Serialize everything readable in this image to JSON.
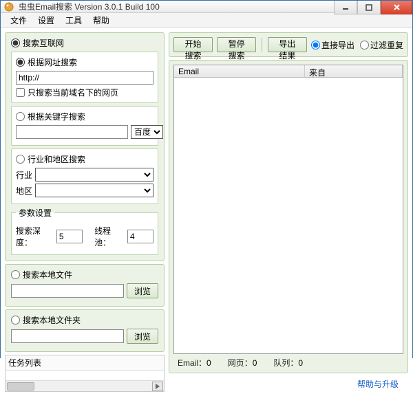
{
  "window": {
    "title": "虫虫Email搜索 Version 3.0.1 Build 100",
    "icon": "app-icon"
  },
  "menu": {
    "file": "文件",
    "settings": "设置",
    "tools": "工具",
    "help": "帮助"
  },
  "left": {
    "searchInternet": {
      "label": "搜索互联网",
      "selected": true,
      "byUrl": {
        "label": "根据网址搜索",
        "selected": true,
        "value": "http://",
        "onlyCurrentDomain": {
          "label": "只搜索当前域名下的网页",
          "checked": false
        }
      },
      "byKeyword": {
        "label": "根据关键字搜索",
        "selected": false,
        "value": "",
        "engine": {
          "options": [
            "百度"
          ],
          "value": "百度"
        }
      },
      "byIndustry": {
        "label": "行业和地区搜索",
        "selected": false,
        "industryLabel": "行业",
        "regionLabel": "地区",
        "industry": "",
        "region": ""
      },
      "params": {
        "legend": "参数设置",
        "depthLabel": "搜索深度：",
        "depthValue": "5",
        "threadLabel": "线程池：",
        "threadValue": "4"
      }
    },
    "searchFile": {
      "label": "搜索本地文件",
      "selected": false,
      "value": "",
      "browse": "浏览"
    },
    "searchFolder": {
      "label": "搜索本地文件夹",
      "selected": false,
      "value": "",
      "browse": "浏览"
    },
    "taskListHeader": "任务列表"
  },
  "toolbar": {
    "start": "开始搜索",
    "pause": "暂停搜索",
    "export": "导出结果",
    "directExport": "直接导出",
    "filterDup": "过滤重复",
    "exportMode": "direct"
  },
  "grid": {
    "col1": "Email",
    "col2": "来自"
  },
  "status": {
    "emailLabel": "Email：",
    "emailCount": "0",
    "pageLabel": "网页：",
    "pageCount": "0",
    "queueLabel": "队列：",
    "queueCount": "0"
  },
  "footer": {
    "link": "帮助与升级"
  }
}
